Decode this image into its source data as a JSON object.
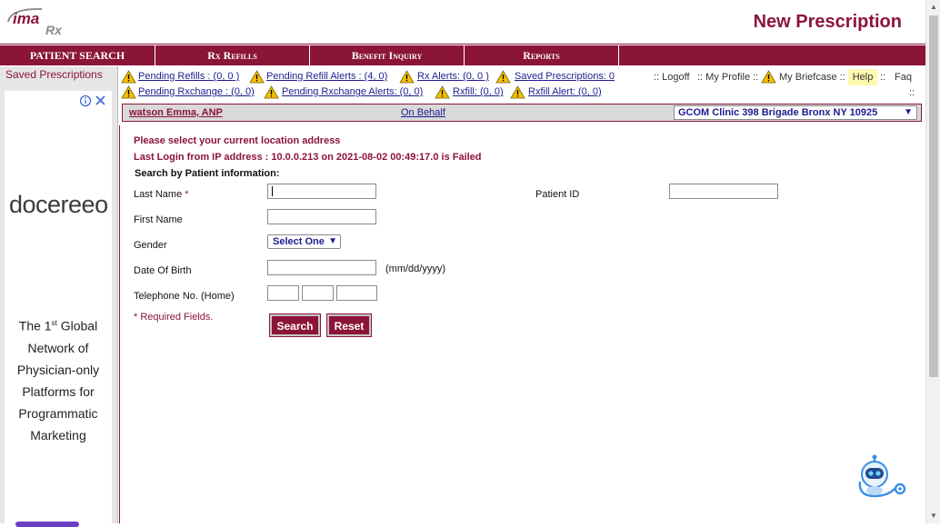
{
  "header": {
    "logo_text": "ima",
    "logo_sub": "Rx",
    "title": "New Prescription"
  },
  "nav": [
    "PATIENT SEARCH",
    "Rx Refills",
    "Benefit Inquiry",
    "Reports"
  ],
  "sidebar": {
    "saved_label": "Saved Prescriptions",
    "ad": {
      "brand": "docereeo",
      "tagline_line1": "The 1",
      "tagline_sup": "st",
      "tagline_line1b": " Global",
      "tagline_rest": [
        "Network of",
        "Physician-only",
        "Platforms for",
        "Programmatic",
        "Marketing"
      ]
    }
  },
  "alerts": {
    "pending_refills": "Pending Refills : (0, 0 )",
    "pending_refill_alerts": "Pending Refill Alerts : (4, 0)",
    "rx_alerts": "Rx Alerts: (0, 0 )",
    "saved_prescriptions": "Saved Prescriptions: 0",
    "pending_rxchange": "Pending Rxchange : (0, 0)",
    "pending_rxchange_alerts": "Pending Rxchange Alerts: (0, 0)",
    "rxfill": "Rxfill: (0, 0)",
    "rxfill_alert": "Rxfill Alert: (0, 0)"
  },
  "utility": {
    "logoff": ":: Logoff",
    "my_profile": ":: My Profile ::",
    "my_briefcase": "My Briefcase ::",
    "help": "Help",
    "faq_sep": "::",
    "faq": "Faq",
    "trailing": "::"
  },
  "provider": {
    "name": "watson Emma, ANP",
    "on_behalf": "On Behalf",
    "clinic": "GCOM Clinic 398 Brigade Bronx NY 10925"
  },
  "form": {
    "msg_location": "Please select your current location address",
    "msg_login": "Last Login from IP address : 10.0.0.213 on 2021-08-02 00:49:17.0 is Failed",
    "section": "Search by Patient information:",
    "last_name": "Last Name",
    "required_star": "*",
    "first_name": "First Name",
    "gender": "Gender",
    "gender_value": "Select One",
    "dob": "Date Of Birth",
    "dob_hint": "(mm/dd/yyyy)",
    "phone": "Telephone No. (Home)",
    "patient_id": "Patient ID",
    "required_note": "* Required Fields.",
    "search": "Search",
    "reset": "Reset"
  },
  "colors": {
    "brand": "#8b1538",
    "link": "#1d1d8f"
  }
}
